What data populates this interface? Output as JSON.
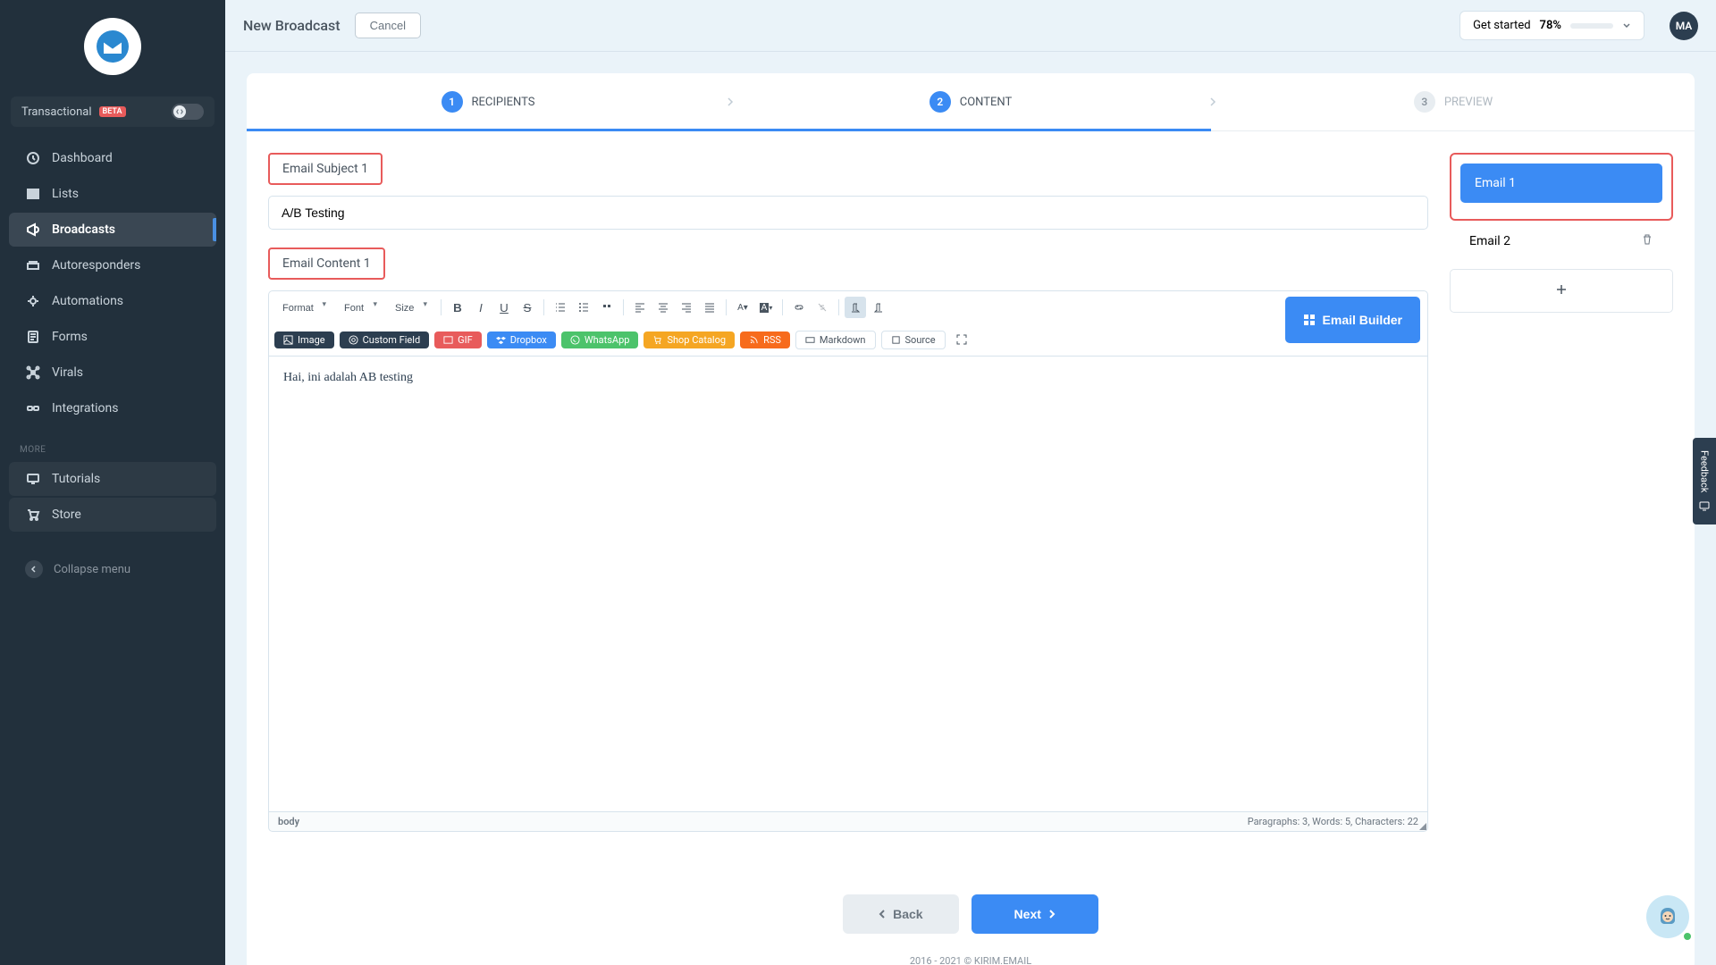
{
  "sidebar": {
    "transactional_label": "Transactional",
    "beta_label": "BETA",
    "items": [
      {
        "label": "Dashboard",
        "icon": "dashboard"
      },
      {
        "label": "Lists",
        "icon": "lists"
      },
      {
        "label": "Broadcasts",
        "icon": "broadcasts",
        "active": true
      },
      {
        "label": "Autoresponders",
        "icon": "autoresponders"
      },
      {
        "label": "Automations",
        "icon": "automations"
      },
      {
        "label": "Forms",
        "icon": "forms"
      },
      {
        "label": "Virals",
        "icon": "virals"
      },
      {
        "label": "Integrations",
        "icon": "integrations"
      }
    ],
    "more_label": "MORE",
    "more_items": [
      {
        "label": "Tutorials",
        "icon": "tutorials"
      },
      {
        "label": "Store",
        "icon": "store"
      }
    ],
    "collapse_label": "Collapse menu"
  },
  "header": {
    "title": "New Broadcast",
    "cancel_label": "Cancel",
    "get_started_label": "Get started",
    "progress_percent": "78%",
    "progress_value": 78,
    "avatar_initials": "MA"
  },
  "stepper": {
    "steps": [
      {
        "num": "1",
        "label": "RECIPIENTS",
        "state": "done"
      },
      {
        "num": "2",
        "label": "CONTENT",
        "state": "active"
      },
      {
        "num": "3",
        "label": "PREVIEW",
        "state": "pending"
      }
    ]
  },
  "content": {
    "subject_label": "Email Subject 1",
    "subject_value": "A/B Testing",
    "content_label": "Email Content 1",
    "toolbar": {
      "format_label": "Format",
      "font_label": "Font",
      "size_label": "Size",
      "image_label": "Image",
      "custom_field_label": "Custom Field",
      "gif_label": "GIF",
      "dropbox_label": "Dropbox",
      "whatsapp_label": "WhatsApp",
      "shop_label": "Shop Catalog",
      "rss_label": "RSS",
      "markdown_label": "Markdown",
      "source_label": "Source",
      "email_builder_label": "Email Builder"
    },
    "editor_text": "Hai, ini adalah AB testing",
    "status_path": "body",
    "status_stats": "Paragraphs: 3, Words: 5, Characters: 22"
  },
  "email_tabs": {
    "tabs": [
      {
        "label": "Email 1",
        "active": true
      },
      {
        "label": "Email 2",
        "active": false
      }
    ]
  },
  "footer": {
    "back_label": "Back",
    "next_label": "Next",
    "copyright": "2016 - 2021 © KIRIM.EMAIL"
  },
  "feedback_label": "Feedback"
}
